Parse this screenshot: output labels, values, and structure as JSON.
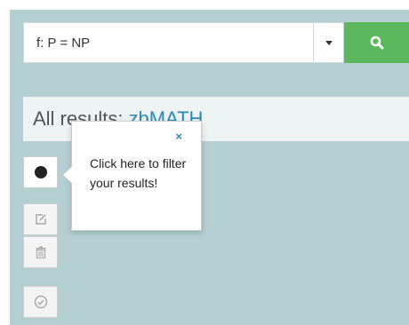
{
  "search": {
    "query": "f: P = NP",
    "search_icon": "search-icon",
    "dropdown_icon": "caret-down-icon"
  },
  "results": {
    "prefix": "All results:",
    "source": "zbMATH"
  },
  "toolbar": {
    "filter_icon": "dot-icon",
    "edit_icon": "edit-icon",
    "delete_icon": "trash-icon",
    "check_icon": "check-circle-icon"
  },
  "popover": {
    "close_label": "×",
    "text": "Click here to filter your results!"
  },
  "colors": {
    "panel_bg": "#b3cfd1",
    "search_button": "#5cb85c",
    "link": "#2a8ab0",
    "header_bg": "#eef3f4"
  }
}
